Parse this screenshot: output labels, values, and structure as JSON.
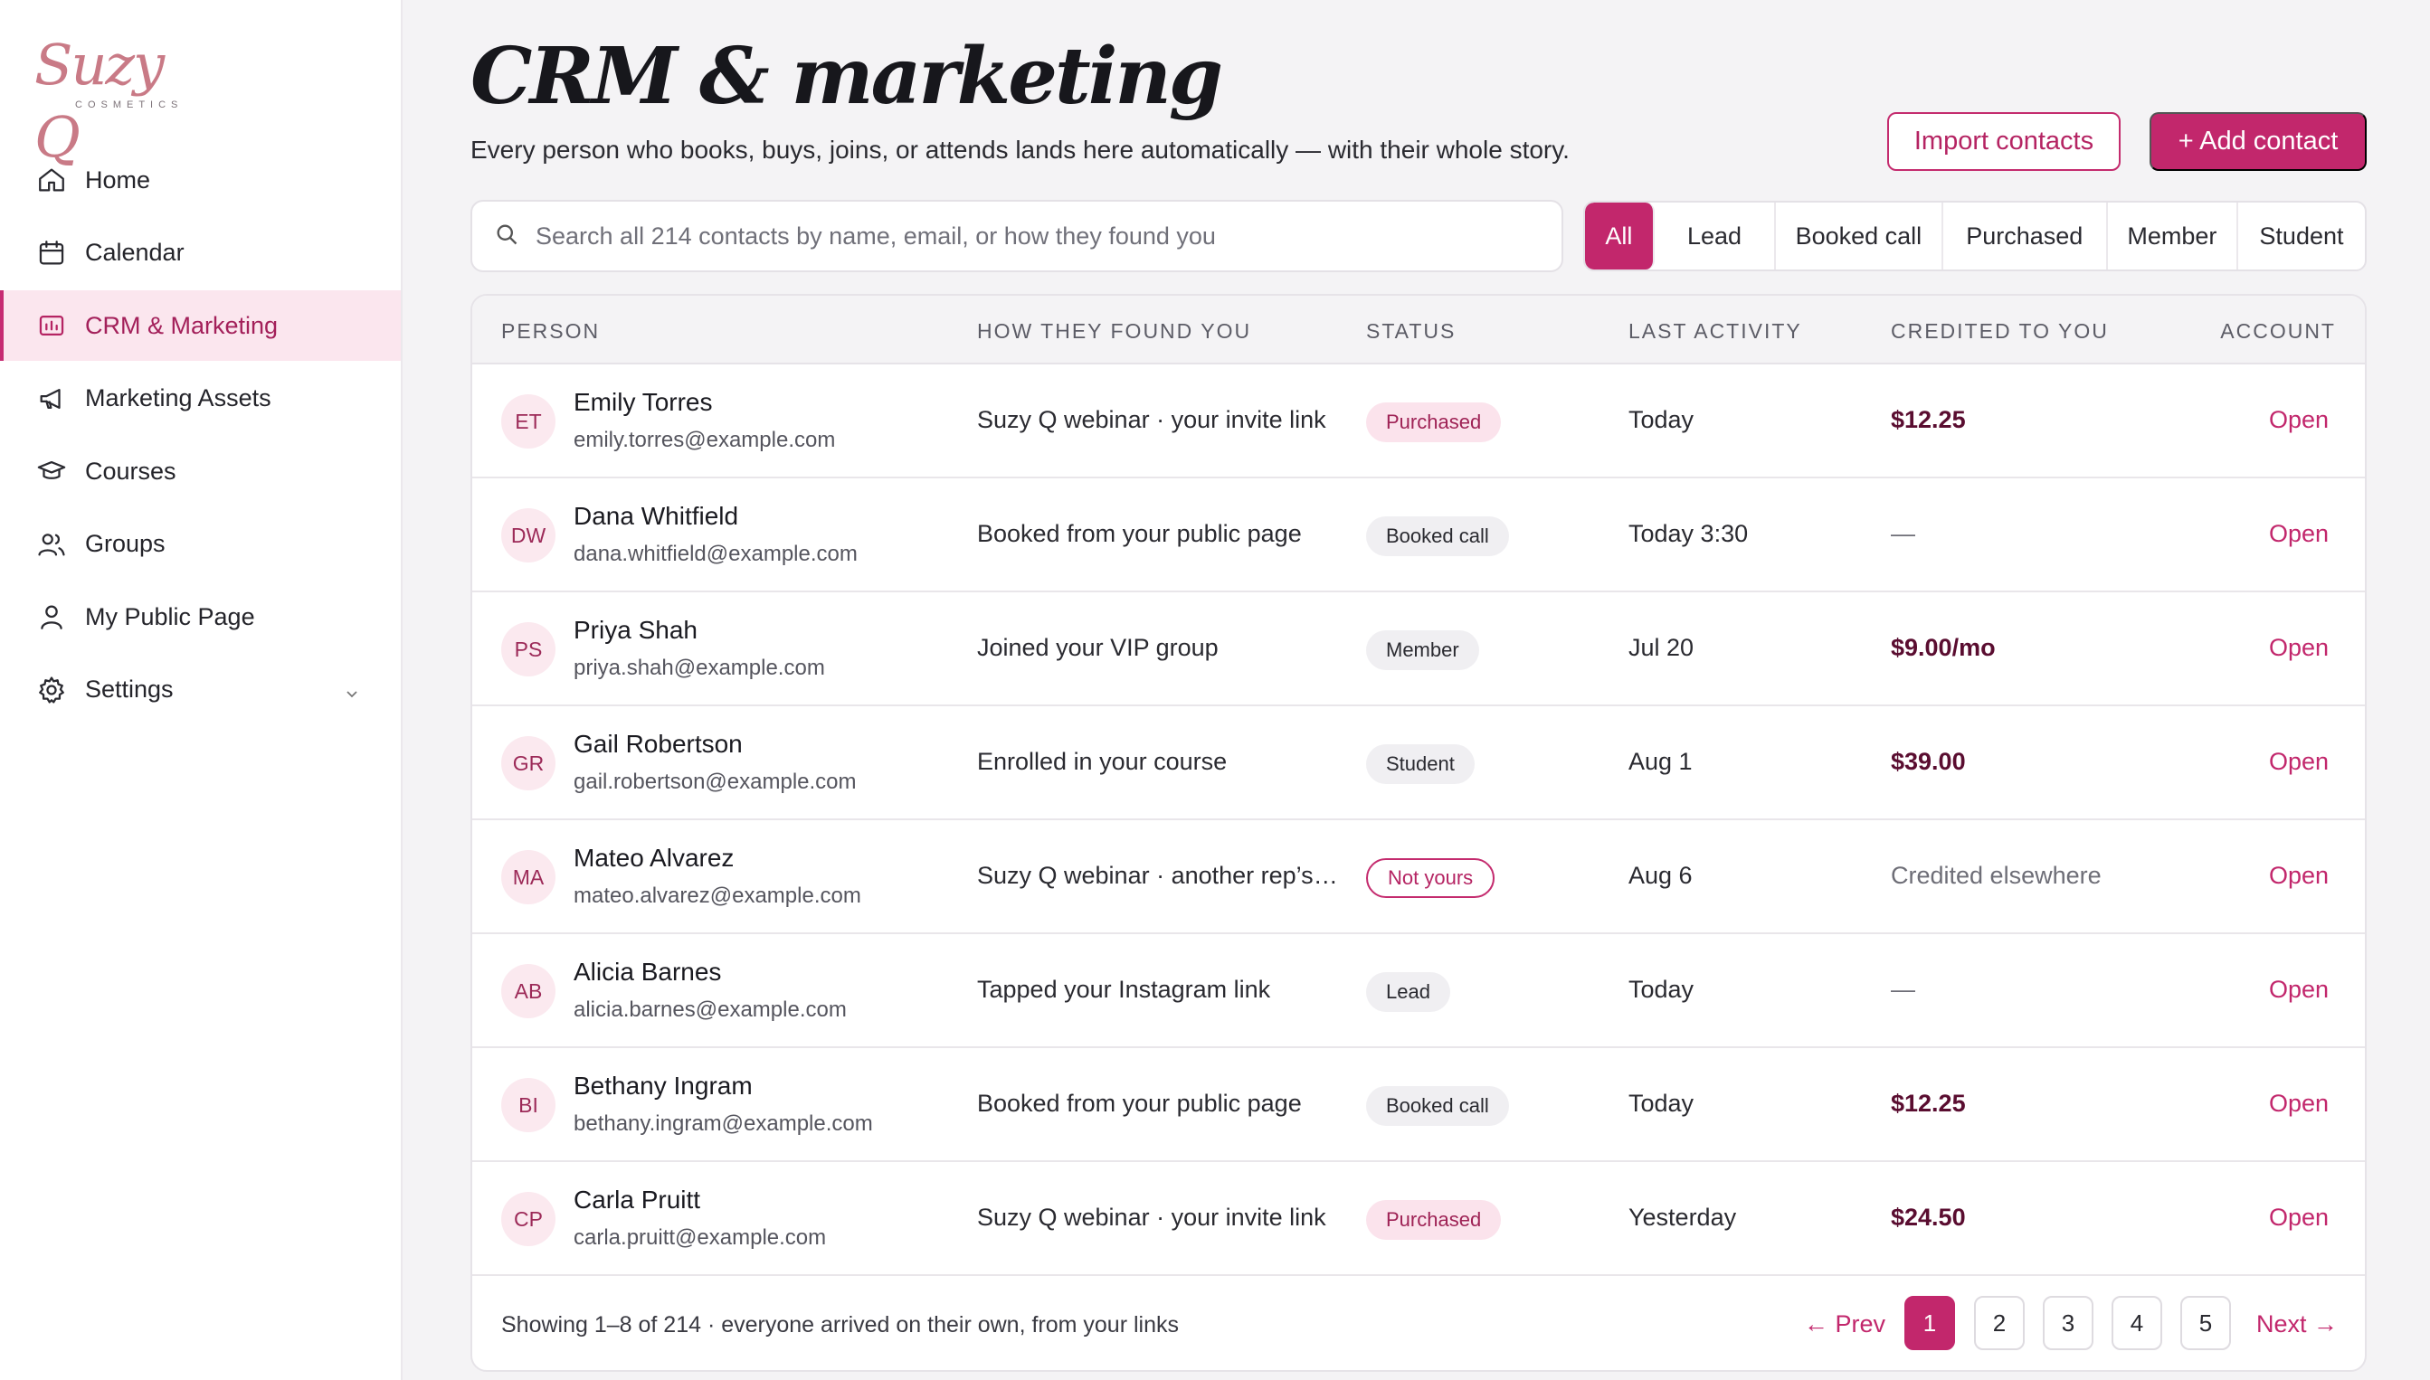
{
  "brand": {
    "logo_text": "Suzy Q",
    "logo_sub": "COSMETICS",
    "accent": "#c2276c"
  },
  "sidebar": {
    "items": [
      {
        "label": "Home",
        "icon": "home-icon"
      },
      {
        "label": "Calendar",
        "icon": "calendar-icon"
      },
      {
        "label": "CRM & Marketing",
        "icon": "chart-icon",
        "active": true
      },
      {
        "label": "Marketing Assets",
        "icon": "megaphone-icon"
      },
      {
        "label": "Courses",
        "icon": "graduation-cap-icon"
      },
      {
        "label": "Groups",
        "icon": "users-icon"
      },
      {
        "label": "My Public Page",
        "icon": "user-icon"
      },
      {
        "label": "Settings",
        "icon": "gear-icon"
      }
    ]
  },
  "header": {
    "title": "CRM & marketing",
    "subtitle": "Every person who books, buys, joins, or attends lands here automatically — with their whole story.",
    "import_label": "Import contacts",
    "add_label": "+ Add contact"
  },
  "search": {
    "placeholder": "Search all 214 contacts by name, email, or how they found you"
  },
  "filters": [
    "All",
    "Lead",
    "Booked call",
    "Purchased",
    "Member",
    "Student"
  ],
  "table": {
    "columns": [
      "PERSON",
      "HOW THEY FOUND YOU",
      "STATUS",
      "LAST ACTIVITY",
      "CREDITED TO YOU",
      "ACCOUNT"
    ],
    "rows": [
      {
        "initials": "ET",
        "name": "Emily Torres",
        "email": "emily.torres@example.com",
        "found": "Suzy Q webinar · your invite link",
        "status": "Purchased",
        "activity": "Today",
        "credit": "$12.25",
        "account": "Open"
      },
      {
        "initials": "DW",
        "name": "Dana Whitfield",
        "email": "dana.whitfield@example.com",
        "found": "Booked from your public page",
        "status": "Booked call",
        "activity": "Today 3:30",
        "credit": "—",
        "account": "Open"
      },
      {
        "initials": "PS",
        "name": "Priya Shah",
        "email": "priya.shah@example.com",
        "found": "Joined your VIP group",
        "status": "Member",
        "activity": "Jul 20",
        "credit": "$9.00/mo",
        "account": "Open"
      },
      {
        "initials": "GR",
        "name": "Gail Robertson",
        "email": "gail.robertson@example.com",
        "found": "Enrolled in your course",
        "status": "Student",
        "activity": "Aug 1",
        "credit": "$39.00",
        "account": "Open"
      },
      {
        "initials": "MA",
        "name": "Mateo Alvarez",
        "email": "mateo.alvarez@example.com",
        "found": "Suzy Q webinar · another rep’s li...",
        "status": "Not yours",
        "activity": "Aug 6",
        "credit": "Credited elsewhere",
        "account": "Open"
      },
      {
        "initials": "AB",
        "name": "Alicia Barnes",
        "email": "alicia.barnes@example.com",
        "found": "Tapped your Instagram link",
        "status": "Lead",
        "activity": "Today",
        "credit": "—",
        "account": "Open"
      },
      {
        "initials": "BI",
        "name": "Bethany Ingram",
        "email": "bethany.ingram@example.com",
        "found": "Booked from your public page",
        "status": "Booked call",
        "activity": "Today",
        "credit": "$12.25",
        "account": "Open"
      },
      {
        "initials": "CP",
        "name": "Carla Pruitt",
        "email": "carla.pruitt@example.com",
        "found": "Suzy Q webinar · your invite link",
        "status": "Purchased",
        "activity": "Yesterday",
        "credit": "$24.50",
        "account": "Open"
      }
    ]
  },
  "pagination": {
    "showing": "Showing 1–8 of 214 · everyone arrived on their own, from your links",
    "prev": "← Prev",
    "pages": [
      "1",
      "2",
      "3",
      "4",
      "5"
    ],
    "current": "1",
    "next": "Next →"
  }
}
